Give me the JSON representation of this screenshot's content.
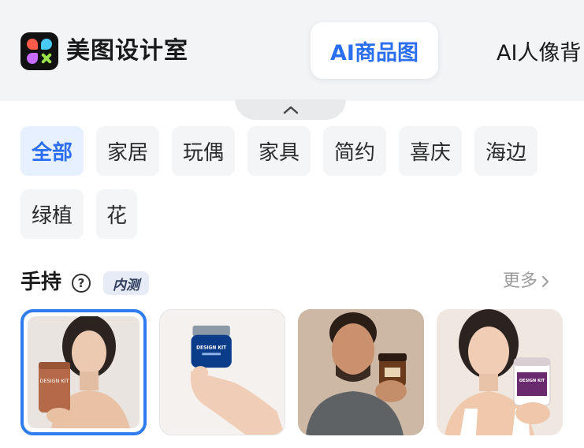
{
  "header": {
    "app_name": "美图设计室",
    "tabs": [
      {
        "label": "AI商品图",
        "active": true
      },
      {
        "label": "AI人像背"
      }
    ],
    "accent_color": "#2b6ff0"
  },
  "categories": [
    {
      "label": "全部",
      "active": true
    },
    {
      "label": "家居"
    },
    {
      "label": "玩偶"
    },
    {
      "label": "家具"
    },
    {
      "label": "简约"
    },
    {
      "label": "喜庆"
    },
    {
      "label": "海边"
    },
    {
      "label": "绿植"
    },
    {
      "label": "花"
    }
  ],
  "section": {
    "title": "手持",
    "help_icon": "?",
    "badge": "内测",
    "more_label": "更多"
  },
  "product_label": "DESIGN KIT",
  "thumbnails": [
    {
      "name": "woman-holding-clay-jar",
      "selected": true
    },
    {
      "name": "hand-holding-blue-jar",
      "selected": false
    },
    {
      "name": "man-holding-amber-jar",
      "selected": false
    },
    {
      "name": "woman-holding-purple-jar",
      "selected": false
    }
  ]
}
